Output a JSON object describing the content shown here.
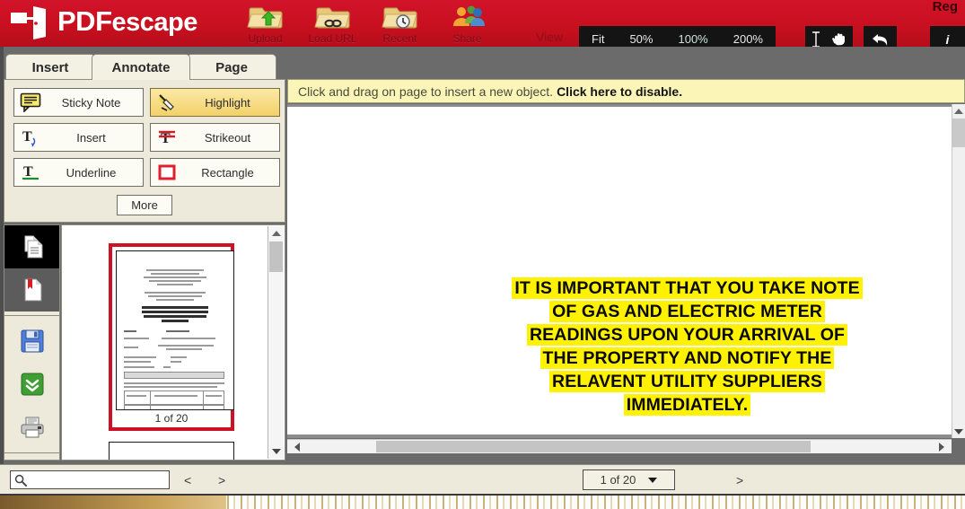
{
  "app": {
    "brand_pdf": "PDF",
    "brand_escape": "escape",
    "register_label": "Reg",
    "accent_red": "#cc1224",
    "highlight_yellow": "#fff200",
    "selected_tool_gold": "#f3d169"
  },
  "topnav": {
    "items": [
      {
        "label": "Upload",
        "icon": "folder-upload-icon"
      },
      {
        "label": "Load URL",
        "icon": "folder-link-icon"
      },
      {
        "label": "Recent",
        "icon": "folder-clock-icon"
      },
      {
        "label": "Share",
        "icon": "share-people-icon"
      }
    ]
  },
  "viewbar": {
    "label": "View",
    "buttons": [
      {
        "label": "Fit",
        "name": "fit"
      },
      {
        "label": "50%",
        "name": "zoom-50"
      },
      {
        "label": "100%",
        "name": "zoom-100"
      },
      {
        "label": "200%",
        "name": "zoom-200"
      }
    ],
    "tools": [
      {
        "icon": "text-cursor-icon",
        "name": "select-text-tool"
      },
      {
        "icon": "hand-icon",
        "name": "pan-tool"
      }
    ],
    "undo_icon": "undo-arrow-icon",
    "info_label": "i"
  },
  "tabs": [
    {
      "label": "Insert",
      "name": "tab-insert",
      "active": false
    },
    {
      "label": "Annotate",
      "name": "tab-annotate",
      "active": true
    },
    {
      "label": "Page",
      "name": "tab-page",
      "active": false
    }
  ],
  "tools": {
    "items": [
      {
        "label": "Sticky Note",
        "icon": "sticky-note-icon",
        "selected": false
      },
      {
        "label": "Highlight",
        "icon": "highlighter-icon",
        "selected": true
      },
      {
        "label": "Insert",
        "icon": "insert-text-icon",
        "selected": false
      },
      {
        "label": "Strikeout",
        "icon": "strikeout-icon",
        "selected": false
      },
      {
        "label": "Underline",
        "icon": "underline-icon",
        "selected": false
      },
      {
        "label": "Rectangle",
        "icon": "rectangle-icon",
        "selected": false
      }
    ],
    "more_label": "More"
  },
  "rail": {
    "items": [
      {
        "name": "pages-panel",
        "icon": "pages-icon",
        "state": "active"
      },
      {
        "name": "bookmarks-panel",
        "icon": "bookmark-page-icon",
        "state": "dim"
      },
      {
        "name": "save-document",
        "icon": "floppy-save-icon",
        "state": "normal"
      },
      {
        "name": "download-document",
        "icon": "download-green-icon",
        "state": "normal"
      },
      {
        "name": "print-document",
        "icon": "printer-icon",
        "state": "normal"
      },
      {
        "name": "new-page",
        "icon": "blue-square-icon",
        "state": "normal"
      }
    ]
  },
  "thumbnails": {
    "current": {
      "caption": "1 of 20",
      "selected": true
    }
  },
  "notice": {
    "text": "Click and drag on page to insert a new object.",
    "action": "Click here to disable."
  },
  "document": {
    "highlight_lines": [
      "IT IS IMPORTANT THAT YOU TAKE NOTE",
      "OF GAS AND ELECTRIC METER",
      "READINGS UPON YOUR ARRIVAL OF",
      "THE PROPERTY AND NOTIFY THE",
      "RELAVENT UTILITY SUPPLIERS",
      "IMMEDIATELY."
    ]
  },
  "bottombar": {
    "search_placeholder": "",
    "search_value": "",
    "search_icon": "magnifier-icon",
    "prev_label": "<",
    "next_small_label": ">",
    "page_select_value": "1 of 20",
    "next_big_label": ">"
  }
}
